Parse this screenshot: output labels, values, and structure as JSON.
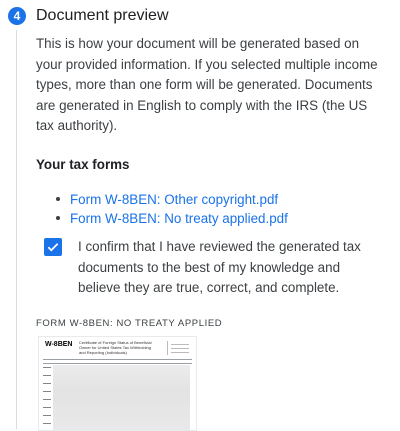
{
  "step": {
    "number": "4",
    "title": "Document preview"
  },
  "intro": "This is how your document will be generated based on your provided information. If you selected multiple income types, more than one form will be generated. Documents are generated in English to comply with the IRS (the US tax authority).",
  "tax_forms": {
    "heading": "Your tax forms",
    "items": [
      {
        "label": "Form W-8BEN: Other copyright.pdf"
      },
      {
        "label": "Form W-8BEN: No treaty applied.pdf"
      }
    ]
  },
  "confirm": {
    "checked": true,
    "text": "I confirm that I have reviewed the generated tax documents to the best of my knowledge and believe they are true, correct, and complete."
  },
  "preview": {
    "label": "FORM W-8BEN: NO TREATY APPLIED",
    "form_code": "W-8BEN",
    "form_title": "Certificate of Foreign Status of Beneficial Owner for United States Tax Withholding and Reporting (Individuals)"
  },
  "colors": {
    "accent": "#1a73e8",
    "text": "#3c4043"
  }
}
